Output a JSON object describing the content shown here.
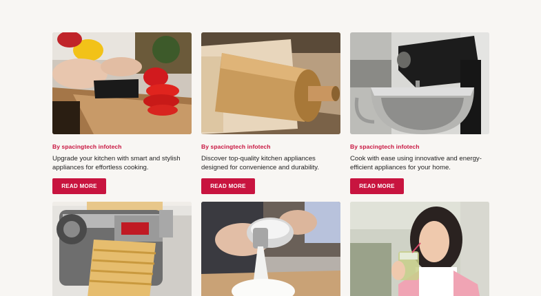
{
  "posts": [
    {
      "image_alt": "Hands slicing red bell pepper on wooden cutting board",
      "byline": "By spacingtech infotech",
      "description": "Upgrade your kitchen with smart and stylish appliances for effortless cooking.",
      "button_label": "READ MORE"
    },
    {
      "image_alt": "Wooden rolling pin on dough",
      "byline": "By spacingtech infotech",
      "description": "Discover top-quality kitchen appliances designed for convenience and durability.",
      "button_label": "READ MORE"
    },
    {
      "image_alt": "Black stand mixer with stainless steel bowl",
      "byline": "By spacingtech infotech",
      "description": "Cook with ease using innovative and energy-efficient appliances for your home.",
      "button_label": "READ MORE"
    },
    {
      "image_alt": "Chrome pasta maker rolling pasta sheets"
    },
    {
      "image_alt": "Flour being poured from measuring cup"
    },
    {
      "image_alt": "Woman drinking a green smoothie"
    }
  ],
  "colors": {
    "accent": "#c8143f",
    "background": "#f8f6f3",
    "text": "#1f1f1f"
  }
}
